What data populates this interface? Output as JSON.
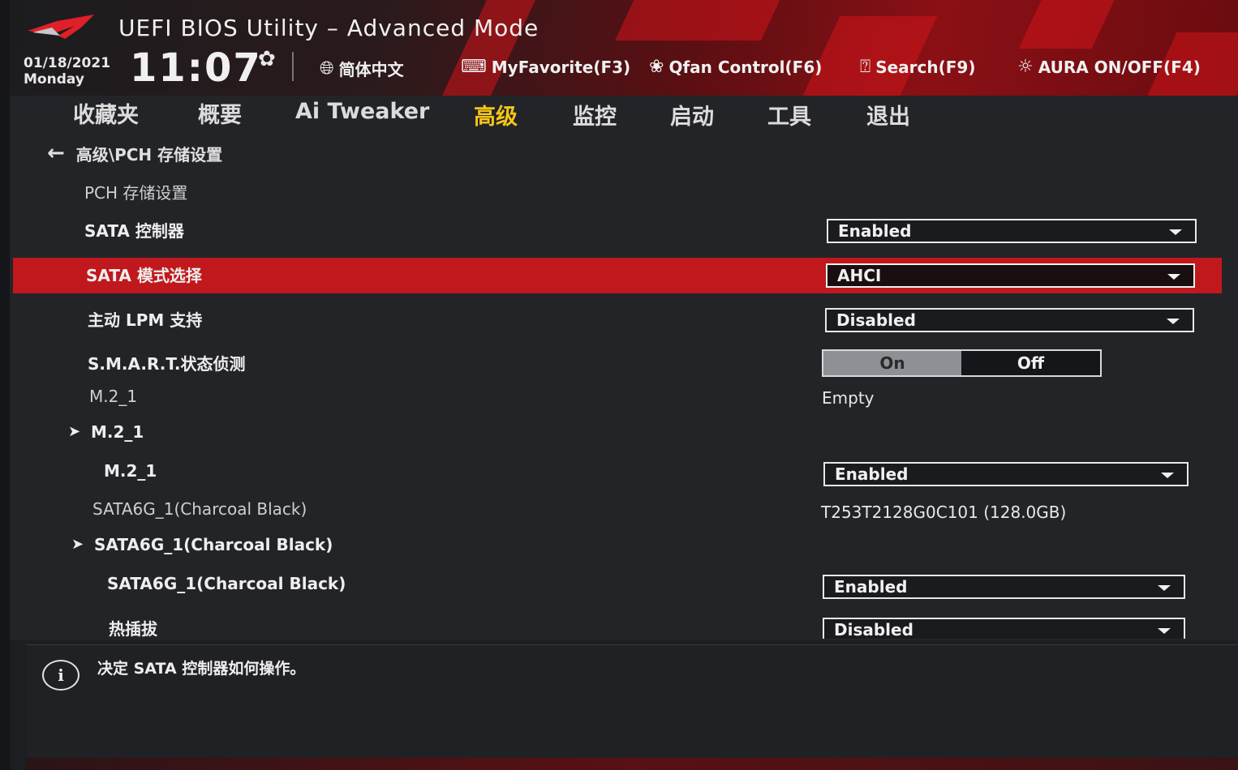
{
  "header": {
    "title": "UEFI BIOS Utility – Advanced Mode",
    "date": "01/18/2021",
    "day": "Monday",
    "time": "11:07",
    "toolbar": [
      {
        "icon": "globe-icon",
        "label": "简体中文"
      },
      {
        "icon": "keyboard-icon",
        "label": "MyFavorite(F3)"
      },
      {
        "icon": "fan-icon",
        "label": "Qfan Control(F6)"
      },
      {
        "icon": "search-help-icon",
        "label": "Search(F9)"
      },
      {
        "icon": "aura-icon",
        "label": "AURA ON/OFF(F4)"
      }
    ]
  },
  "tabs": [
    "收藏夹",
    "概要",
    "Ai Tweaker",
    "高级",
    "监控",
    "启动",
    "工具",
    "退出"
  ],
  "active_tab": "高级",
  "breadcrumb": "高级\\PCH 存储设置",
  "section_title": "PCH 存储设置",
  "rows": {
    "sata_controller": {
      "label": "SATA 控制器",
      "value": "Enabled"
    },
    "sata_mode": {
      "label": "SATA 模式选择",
      "value": "AHCI"
    },
    "lpm": {
      "label": "主动 LPM 支持",
      "value": "Disabled"
    },
    "smart": {
      "label": "S.M.A.R.T.状态侦测",
      "on": "On",
      "off": "Off",
      "selected": "On"
    },
    "m2_info": {
      "label": "M.2_1",
      "value": "Empty"
    },
    "m2_group": {
      "label": "M.2_1"
    },
    "m2_port": {
      "label": "M.2_1",
      "value": "Enabled"
    },
    "sata6g_info": {
      "label": "SATA6G_1(Charcoal Black)",
      "value": "T253T2128G0C101 (128.0GB)"
    },
    "sata6g_group": {
      "label": "SATA6G_1(Charcoal Black)"
    },
    "sata6g_port": {
      "label": "SATA6G_1(Charcoal Black)",
      "value": "Enabled"
    },
    "hotplug": {
      "label": "热插拔",
      "value": "Disabled"
    }
  },
  "help_text": "决定 SATA 控制器如何操作。",
  "colors": {
    "accent": "#c0181c",
    "active_tab": "#f5c518"
  }
}
